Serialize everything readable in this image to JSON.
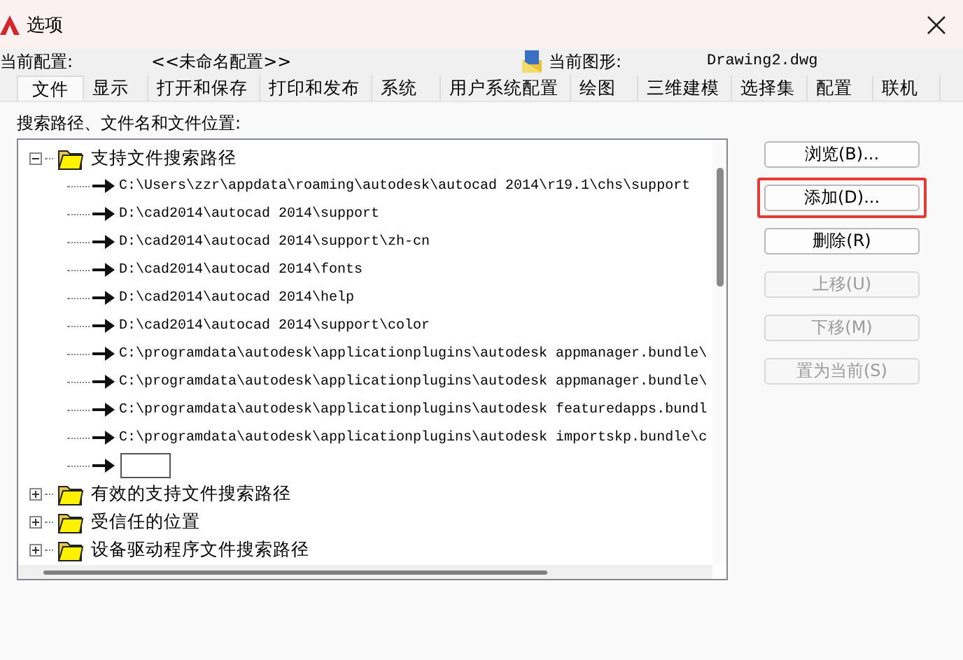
{
  "window": {
    "title": "选项"
  },
  "profile": {
    "label": "当前配置:",
    "value": "<<未命名配置>>",
    "drawing_label": "当前图形:",
    "drawing_value": "Drawing2.dwg"
  },
  "tabs": [
    {
      "label": "文件",
      "selected": true
    },
    {
      "label": "显示",
      "selected": false
    },
    {
      "label": "打开和保存",
      "selected": false
    },
    {
      "label": "打印和发布",
      "selected": false
    },
    {
      "label": "系统",
      "selected": false
    },
    {
      "label": "用户系统配置",
      "selected": false
    },
    {
      "label": "绘图",
      "selected": false
    },
    {
      "label": "三维建模",
      "selected": false
    },
    {
      "label": "选择集",
      "selected": false
    },
    {
      "label": "配置",
      "selected": false
    },
    {
      "label": "联机",
      "selected": false
    }
  ],
  "tree_label": "搜索路径、文件名和文件位置:",
  "tree": [
    {
      "kind": "folder",
      "label": "支持文件搜索路径",
      "expanded": true,
      "children": [
        {
          "kind": "path",
          "label": "C:\\Users\\zzr\\appdata\\roaming\\autodesk\\autocad 2014\\r19.1\\chs\\support"
        },
        {
          "kind": "path",
          "label": "D:\\cad2014\\autocad 2014\\support"
        },
        {
          "kind": "path",
          "label": "D:\\cad2014\\autocad 2014\\support\\zh-cn"
        },
        {
          "kind": "path",
          "label": "D:\\cad2014\\autocad 2014\\fonts"
        },
        {
          "kind": "path",
          "label": "D:\\cad2014\\autocad 2014\\help"
        },
        {
          "kind": "path",
          "label": "D:\\cad2014\\autocad 2014\\support\\color"
        },
        {
          "kind": "path",
          "label": "C:\\programdata\\autodesk\\applicationplugins\\autodesk appmanager.bundle\\"
        },
        {
          "kind": "path",
          "label": "C:\\programdata\\autodesk\\applicationplugins\\autodesk appmanager.bundle\\"
        },
        {
          "kind": "path",
          "label": "C:\\programdata\\autodesk\\applicationplugins\\autodesk featuredapps.bundl"
        },
        {
          "kind": "path",
          "label": "C:\\programdata\\autodesk\\applicationplugins\\autodesk importskp.bundle\\c"
        },
        {
          "kind": "editing"
        }
      ]
    },
    {
      "kind": "folder",
      "label": "有效的支持文件搜索路径",
      "expanded": false
    },
    {
      "kind": "folder",
      "label": "受信任的位置",
      "expanded": false
    },
    {
      "kind": "folder",
      "label": "设备驱动程序文件搜索路径",
      "expanded": false
    }
  ],
  "buttons": [
    {
      "label": "浏览(B)...",
      "disabled": false,
      "highlighted": false
    },
    {
      "label": "添加(D)...",
      "disabled": false,
      "highlighted": true
    },
    {
      "label": "删除(R)",
      "disabled": false,
      "highlighted": false
    },
    {
      "label": "上移(U)",
      "disabled": true,
      "highlighted": false
    },
    {
      "label": "下移(M)",
      "disabled": true,
      "highlighted": false
    },
    {
      "label": "置为当前(S)",
      "disabled": true,
      "highlighted": false
    }
  ]
}
